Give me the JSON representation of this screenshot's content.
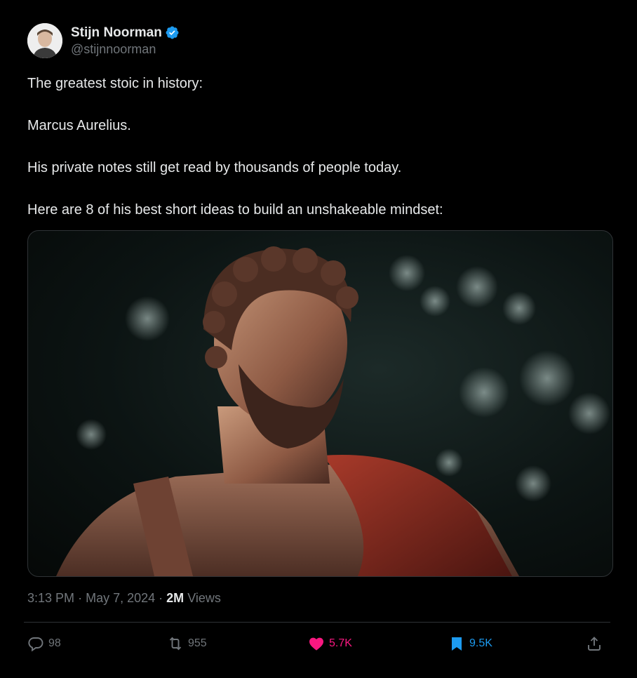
{
  "author": {
    "display_name": "Stijn Noorman",
    "handle": "@stijnnoorman",
    "verified": true,
    "verified_color": "#1d9bf0"
  },
  "tweet": {
    "paragraphs": [
      "The greatest stoic in history:",
      "Marcus Aurelius.",
      "His private notes still get read by thousands of people today.",
      "Here are 8 of his best short ideas to build an unshakeable mindset:"
    ]
  },
  "meta": {
    "time": "3:13 PM",
    "separator": "·",
    "date": "May 7, 2024",
    "views_count": "2M",
    "views_label": "Views"
  },
  "actions": {
    "replies": "98",
    "reposts": "955",
    "likes": "5.7K",
    "bookmarks": "9.5K"
  },
  "colors": {
    "background": "#000000",
    "text": "#e7e9ea",
    "secondary": "#71767b",
    "like": "#f91880",
    "bookmark": "#1d9bf0"
  }
}
